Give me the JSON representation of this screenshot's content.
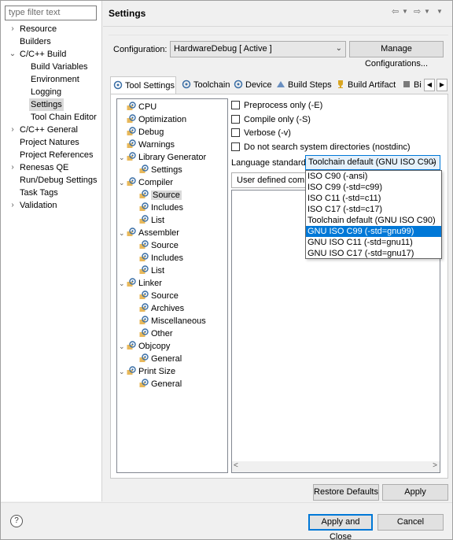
{
  "filter": {
    "placeholder": "type filter text"
  },
  "nav": [
    {
      "label": "Resource",
      "expander": "›"
    },
    {
      "label": "Builders",
      "expander": ""
    },
    {
      "label": "C/C++ Build",
      "expander": "⌄"
    },
    {
      "label": "Build Variables",
      "expander": ""
    },
    {
      "label": "Environment",
      "expander": ""
    },
    {
      "label": "Logging",
      "expander": ""
    },
    {
      "label": "Settings",
      "expander": ""
    },
    {
      "label": "Tool Chain Editor",
      "expander": ""
    },
    {
      "label": "C/C++ General",
      "expander": "›"
    },
    {
      "label": "Project Natures",
      "expander": ""
    },
    {
      "label": "Project References",
      "expander": ""
    },
    {
      "label": "Renesas QE",
      "expander": "›"
    },
    {
      "label": "Run/Debug Settings",
      "expander": ""
    },
    {
      "label": "Task Tags",
      "expander": ""
    },
    {
      "label": "Validation",
      "expander": "›"
    }
  ],
  "page": {
    "title": "Settings"
  },
  "config": {
    "label": "Configuration:",
    "value": "HardwareDebug  [ Active ]",
    "manage_label": "Manage Configurations..."
  },
  "tabs": [
    "Tool Settings",
    "Toolchain",
    "Device",
    "Build Steps",
    "Build Artifact",
    "Bi"
  ],
  "tree": [
    {
      "label": "CPU",
      "expander": ""
    },
    {
      "label": "Optimization",
      "expander": ""
    },
    {
      "label": "Debug",
      "expander": ""
    },
    {
      "label": "Warnings",
      "expander": ""
    },
    {
      "label": "Library Generator",
      "expander": "⌄"
    },
    {
      "label": "Settings",
      "expander": ""
    },
    {
      "label": "Compiler",
      "expander": "⌄"
    },
    {
      "label": "Source",
      "expander": ""
    },
    {
      "label": "Includes",
      "expander": ""
    },
    {
      "label": "List",
      "expander": ""
    },
    {
      "label": "Assembler",
      "expander": "⌄"
    },
    {
      "label": "Source",
      "expander": ""
    },
    {
      "label": "Includes",
      "expander": ""
    },
    {
      "label": "List",
      "expander": ""
    },
    {
      "label": "Linker",
      "expander": "⌄"
    },
    {
      "label": "Source",
      "expander": ""
    },
    {
      "label": "Archives",
      "expander": ""
    },
    {
      "label": "Miscellaneous",
      "expander": ""
    },
    {
      "label": "Other",
      "expander": ""
    },
    {
      "label": "Objcopy",
      "expander": "⌄"
    },
    {
      "label": "General",
      "expander": ""
    },
    {
      "label": "Print Size",
      "expander": "⌄"
    },
    {
      "label": "General",
      "expander": ""
    }
  ],
  "options": [
    "Preprocess only (-E)",
    "Compile only (-S)",
    "Verbose (-v)",
    "Do not search system directories (nostdinc)"
  ],
  "language": {
    "label": "Language standard",
    "value": "Toolchain default (GNU ISO C90)",
    "options": [
      "ISO C90 (-ansi)",
      "ISO C99 (-std=c99)",
      "ISO C11 (-std=c11)",
      "ISO C17 (-std=c17)",
      "Toolchain default (GNU ISO C90)",
      "GNU ISO C99 (-std=gnu99)",
      "GNU ISO C11 (-std=gnu11)",
      "GNU ISO C17 (-std=gnu17)"
    ],
    "highlighted": "GNU ISO C99 (-std=gnu99)"
  },
  "user_defined": {
    "label": "User defined compiler options"
  },
  "buttons": {
    "restore": "Restore Defaults",
    "apply": "Apply",
    "apply_close": "Apply and Close",
    "cancel": "Cancel",
    "help": "?"
  },
  "colors": {
    "accent": "#0078d7",
    "selection": "#d9d9d9",
    "gear": "#3a6ea5",
    "folder": "#e8b85a"
  }
}
